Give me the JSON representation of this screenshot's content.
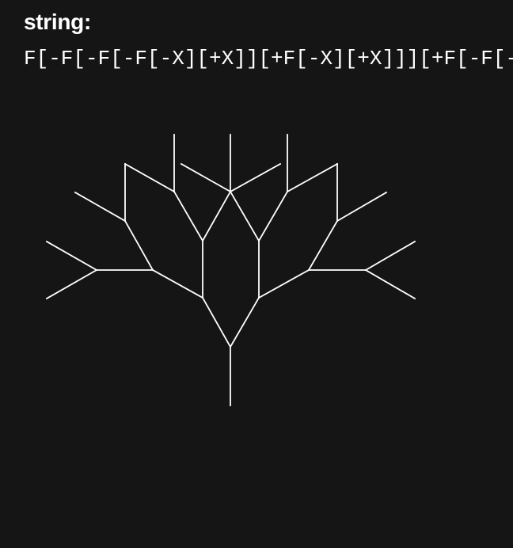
{
  "header": {
    "label": "string:"
  },
  "lsystem": {
    "string": "F[-F[-F[-F[-X][+X]][+F[-X][+X]]][+F[-F[-X][+X]][+F[-X][+X]]]][+F[-F[-F[-X][+X]][+F[-X][+X]]][+F[-F[-X][+X]][+F[-X][+X]]]]",
    "stroke_color": "#ffffff",
    "background_color": "#151515"
  }
}
